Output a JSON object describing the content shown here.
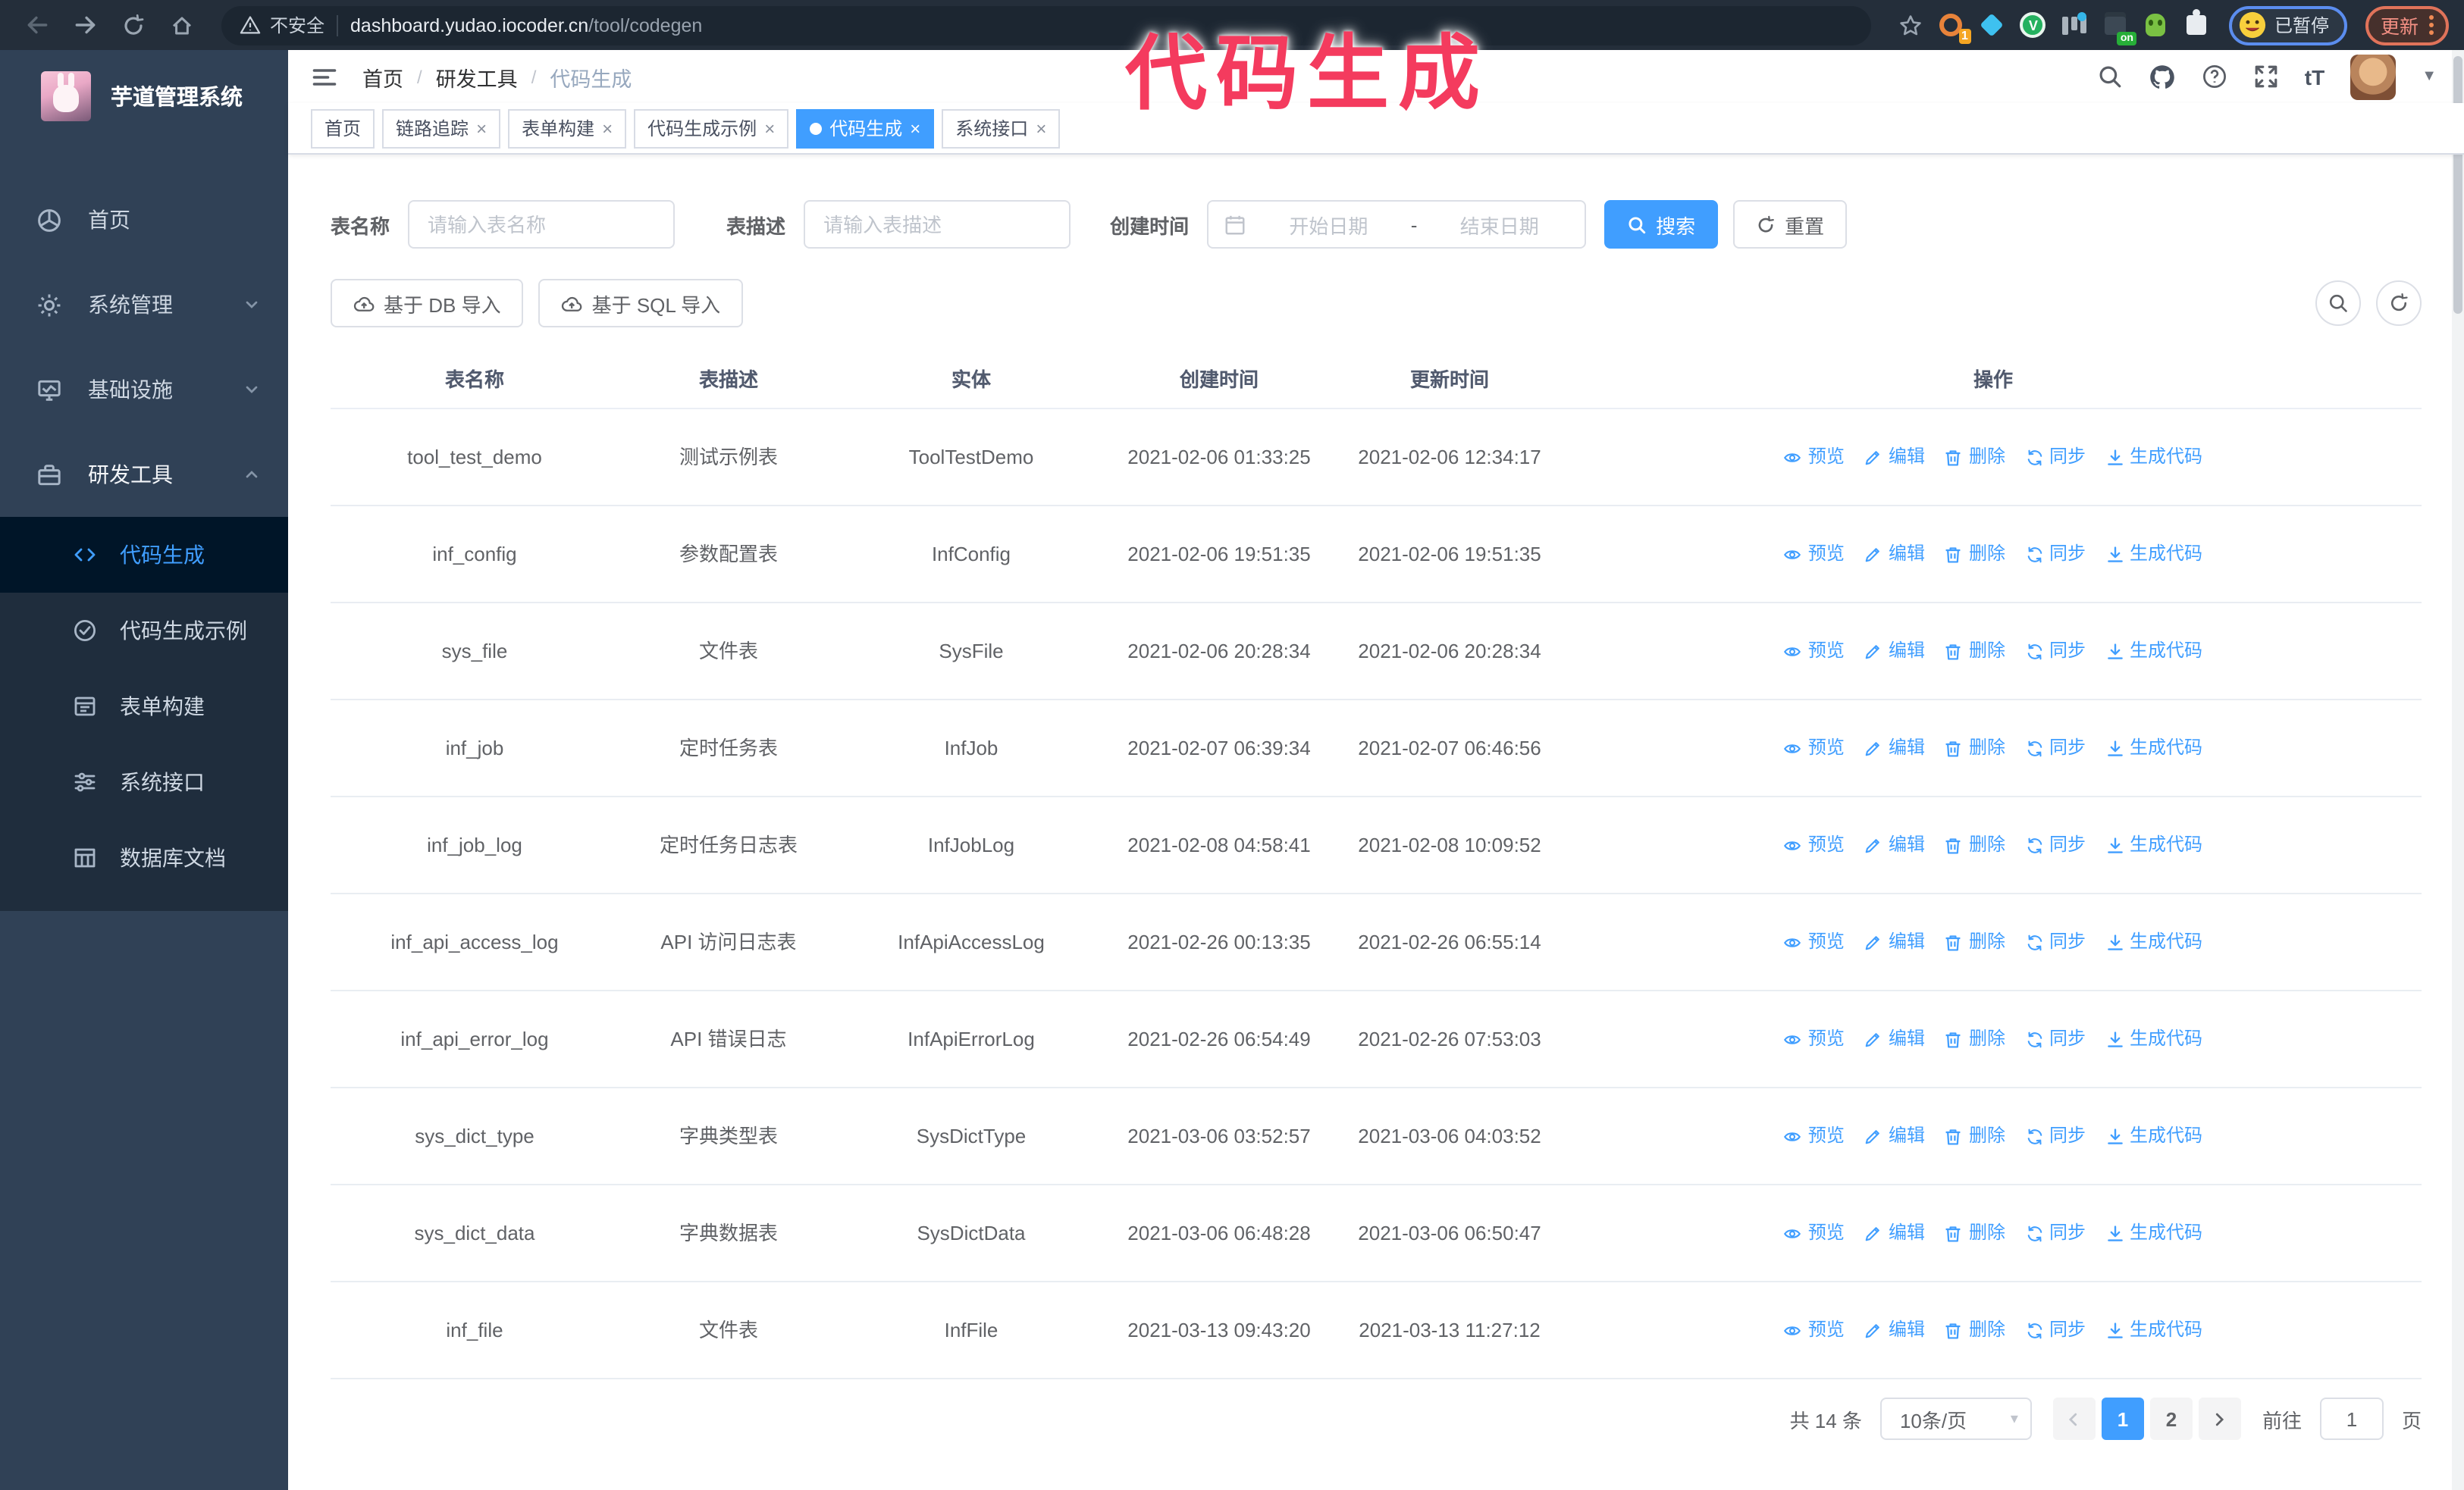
{
  "browser": {
    "security_label": "不安全",
    "url_host": "dashboard.yudao.iocoder.cn",
    "url_path": "/tool/codegen",
    "ext_badge_1": "1",
    "ext_badge_v": "V",
    "ext_badge_on": "on",
    "profile_badge": "已暂停",
    "update_label": "更新"
  },
  "annotation": {
    "text": "代码生成",
    "color": "#f43b5e"
  },
  "sidebar": {
    "title": "芋道管理系统",
    "items": [
      {
        "label": "首页"
      },
      {
        "label": "系统管理"
      },
      {
        "label": "基础设施"
      },
      {
        "label": "研发工具"
      }
    ],
    "sub_items": [
      {
        "label": "代码生成"
      },
      {
        "label": "代码生成示例"
      },
      {
        "label": "表单构建"
      },
      {
        "label": "系统接口"
      },
      {
        "label": "数据库文档"
      }
    ]
  },
  "header": {
    "breadcrumb": [
      "首页",
      "研发工具",
      "代码生成"
    ],
    "separator": "/"
  },
  "tabs": [
    {
      "label": "首页"
    },
    {
      "label": "链路追踪"
    },
    {
      "label": "表单构建"
    },
    {
      "label": "代码生成示例"
    },
    {
      "label": "代码生成"
    },
    {
      "label": "系统接口"
    }
  ],
  "filter": {
    "name_label": "表名称",
    "name_placeholder": "请输入表名称",
    "desc_label": "表描述",
    "desc_placeholder": "请输入表描述",
    "time_label": "创建时间",
    "start_placeholder": "开始日期",
    "separator": "-",
    "end_placeholder": "结束日期",
    "search_label": "搜索",
    "reset_label": "重置"
  },
  "toolbar": {
    "db_import": "基于 DB 导入",
    "sql_import": "基于 SQL 导入"
  },
  "table": {
    "headers": [
      "表名称",
      "表描述",
      "实体",
      "创建时间",
      "更新时间",
      "操作"
    ],
    "action_labels": [
      "预览",
      "编辑",
      "删除",
      "同步",
      "生成代码"
    ],
    "rows": [
      {
        "name": "tool_test_demo",
        "desc": "测试示例表",
        "entity": "ToolTestDemo",
        "create": "2021-02-06 01:33:25",
        "update": "2021-02-06 12:34:17"
      },
      {
        "name": "inf_config",
        "desc": "参数配置表",
        "entity": "InfConfig",
        "create": "2021-02-06 19:51:35",
        "update": "2021-02-06 19:51:35"
      },
      {
        "name": "sys_file",
        "desc": "文件表",
        "entity": "SysFile",
        "create": "2021-02-06 20:28:34",
        "update": "2021-02-06 20:28:34"
      },
      {
        "name": "inf_job",
        "desc": "定时任务表",
        "entity": "InfJob",
        "create": "2021-02-07 06:39:34",
        "update": "2021-02-07 06:46:56"
      },
      {
        "name": "inf_job_log",
        "desc": "定时任务日志表",
        "entity": "InfJobLog",
        "create": "2021-02-08 04:58:41",
        "update": "2021-02-08 10:09:52"
      },
      {
        "name": "inf_api_access_log",
        "desc": "API 访问日志表",
        "entity": "InfApiAccessLog",
        "create": "2021-02-26 00:13:35",
        "update": "2021-02-26 06:55:14"
      },
      {
        "name": "inf_api_error_log",
        "desc": "API 错误日志",
        "entity": "InfApiErrorLog",
        "create": "2021-02-26 06:54:49",
        "update": "2021-02-26 07:53:03"
      },
      {
        "name": "sys_dict_type",
        "desc": "字典类型表",
        "entity": "SysDictType",
        "create": "2021-03-06 03:52:57",
        "update": "2021-03-06 04:03:52"
      },
      {
        "name": "sys_dict_data",
        "desc": "字典数据表",
        "entity": "SysDictData",
        "create": "2021-03-06 06:48:28",
        "update": "2021-03-06 06:50:47"
      },
      {
        "name": "inf_file",
        "desc": "文件表",
        "entity": "InfFile",
        "create": "2021-03-13 09:43:20",
        "update": "2021-03-13 11:27:12"
      }
    ]
  },
  "pagination": {
    "total": "共 14 条",
    "page_size": "10条/页",
    "pages": [
      "1",
      "2"
    ],
    "goto_label": "前往",
    "goto_value": "1",
    "page_unit": "页"
  }
}
